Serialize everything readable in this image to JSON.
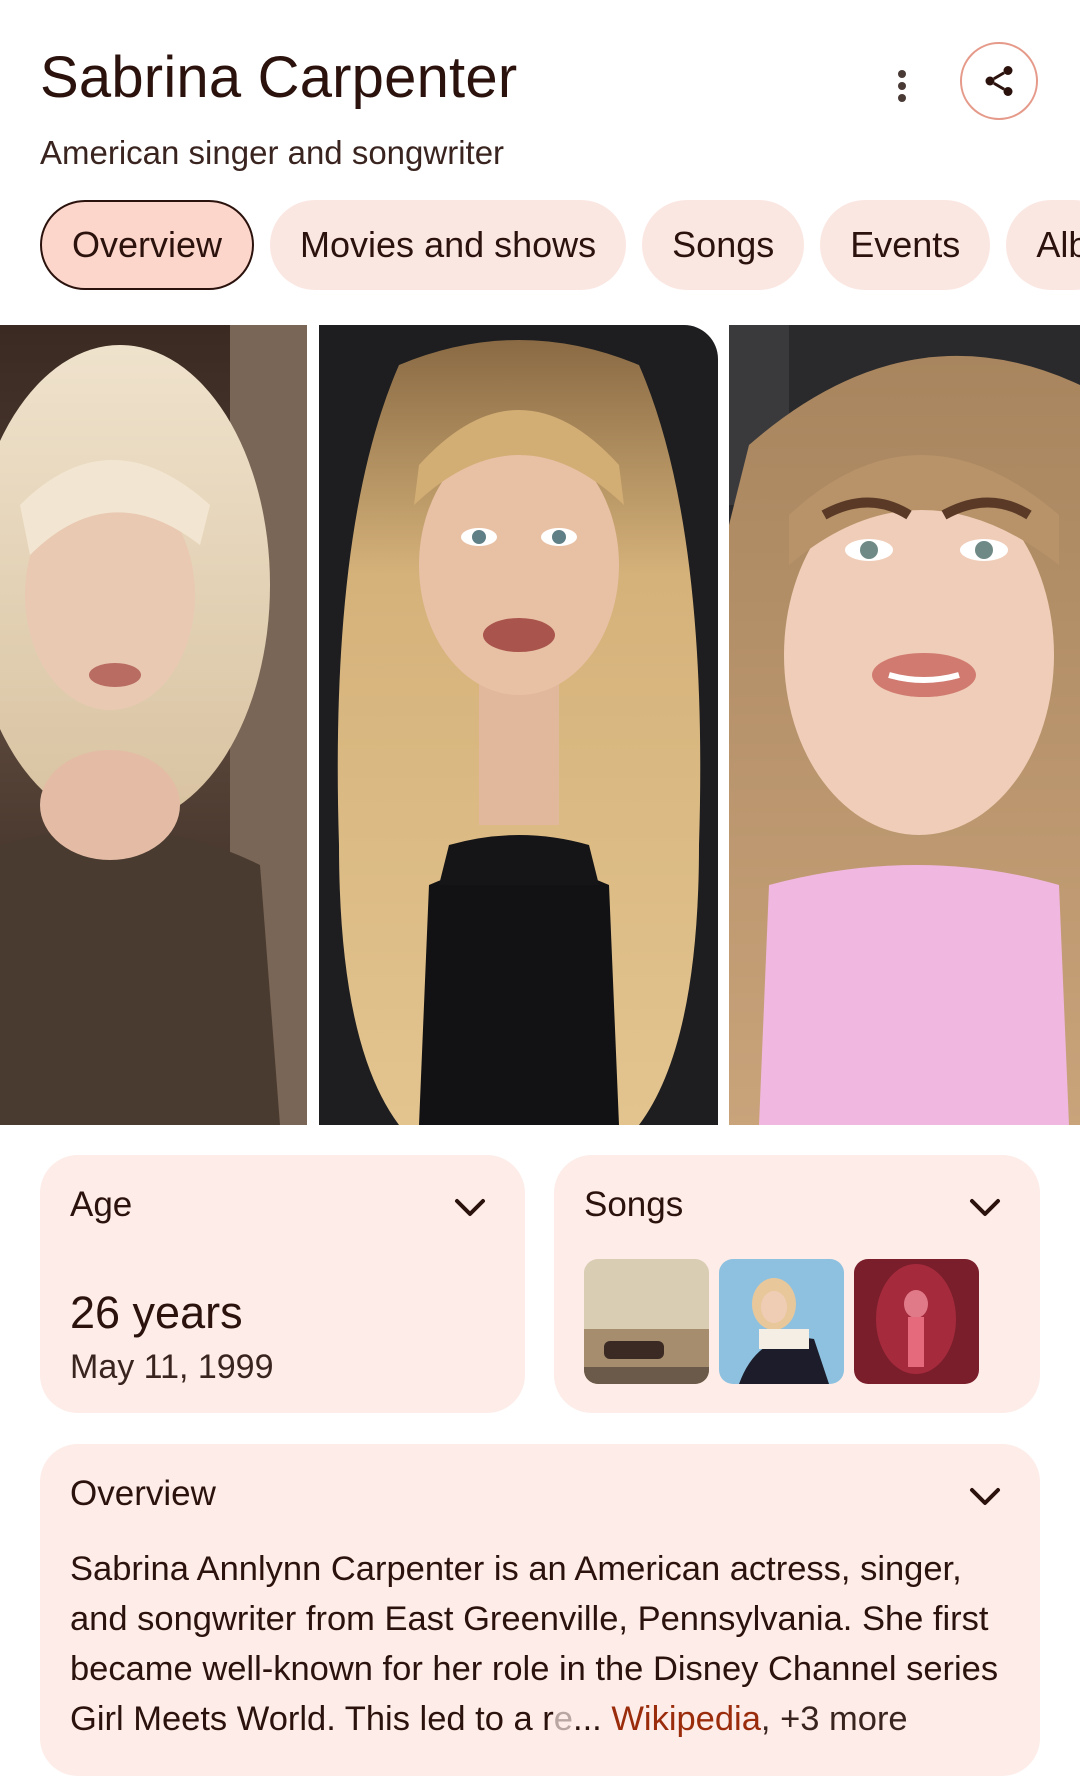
{
  "header": {
    "title": "Sabrina Carpenter",
    "subtitle": "American singer and songwriter"
  },
  "icons": {
    "more": "more-vert-icon",
    "share": "share-icon",
    "expand": "chevron-down-icon"
  },
  "tabs": [
    {
      "label": "Overview",
      "active": true
    },
    {
      "label": "Movies and shows",
      "active": false
    },
    {
      "label": "Songs",
      "active": false
    },
    {
      "label": "Events",
      "active": false
    },
    {
      "label": "Alb",
      "active": false
    }
  ],
  "images": [
    {
      "name": "photo-1"
    },
    {
      "name": "photo-2"
    },
    {
      "name": "photo-3"
    }
  ],
  "age_card": {
    "title": "Age",
    "value": "26 years",
    "birthdate": "May 11, 1999"
  },
  "songs_card": {
    "title": "Songs"
  },
  "overview_card": {
    "title": "Overview",
    "text": "Sabrina Annlynn Carpenter is an American actress, singer, and songwriter from East Greenville, Pennsylvania. She first became well-known for her role in the Disney Channel series Girl Meets World. This led to a r",
    "text_fade": "e",
    "ellipsis": "...",
    "source_link": "Wikipedia",
    "source_sep": ",",
    "more_sources": "+3 more"
  },
  "colors": {
    "accent": "#9a2c0c",
    "chip_bg": "#fbe7e2",
    "chip_active_bg": "#fcd6cb",
    "card_bg": "#fdece7",
    "share_border": "#e59a8a"
  }
}
